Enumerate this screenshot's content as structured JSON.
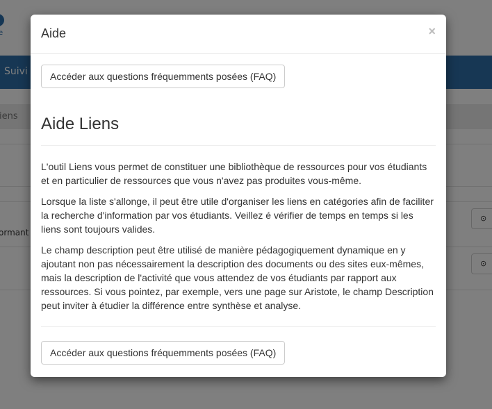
{
  "background": {
    "logo_sub": "e",
    "nav_item": "Suivi",
    "subbar_item": "iens",
    "row_text": "ormant",
    "row_button_icon": "check-circle-icon"
  },
  "modal": {
    "title": "Aide",
    "close_glyph": "×",
    "faq_button_top": "Accéder aux questions fréquemments posées (FAQ)",
    "heading": "Aide Liens",
    "paragraphs": [
      "L'outil Liens vous permet de constituer une bibliothèque de ressources pour vos étudiants et en particulier de ressources que vous n'avez pas produites vous-même.",
      "Lorsque la liste s'allonge, il peut être utile d'organiser les liens en catégories afin de faciliter la recherche d'information par vos étudiants. Veillez é vérifier de temps en temps si les liens sont toujours valides.",
      "Le champ description peut être utilisé de manière pédagogiquement dynamique en y ajoutant non pas nécessairement la description des documents ou des sites eux-mêmes, mais la description de l'activité que vous attendez de vos étudiants par rapport aux ressources. Si vous pointez, par exemple, vers une page sur Aristote, le champ Description peut inviter à étudier la différence entre synthèse et analyse."
    ],
    "faq_button_bottom": "Accéder aux questions fréquemments posées (FAQ)"
  }
}
